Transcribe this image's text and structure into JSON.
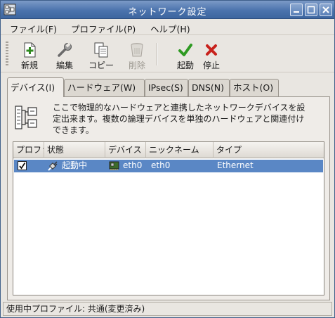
{
  "window": {
    "title": "ネットワーク設定",
    "title_color": "#4b73ad"
  },
  "menubar": {
    "items": [
      {
        "label": "ファイル(F)"
      },
      {
        "label": "プロファイル(P)"
      },
      {
        "label": "ヘルプ(H)"
      }
    ]
  },
  "toolbar": {
    "buttons": [
      {
        "label": "新規",
        "icon": "new-icon",
        "enabled": true
      },
      {
        "label": "編集",
        "icon": "edit-icon",
        "enabled": true
      },
      {
        "label": "コピー",
        "icon": "copy-icon",
        "enabled": true
      },
      {
        "label": "削除",
        "icon": "delete-icon",
        "enabled": false
      },
      {
        "label": "起動",
        "icon": "activate-icon",
        "enabled": true
      },
      {
        "label": "停止",
        "icon": "deactivate-icon",
        "enabled": true
      }
    ]
  },
  "tabs": [
    {
      "label": "デバイス(I)",
      "active": true
    },
    {
      "label": "ハードウェア(W)",
      "active": false
    },
    {
      "label": "IPsec(S)",
      "active": false
    },
    {
      "label": "DNS(N)",
      "active": false
    },
    {
      "label": "ホスト(O)",
      "active": false
    }
  ],
  "devices_panel": {
    "description": "ここで物理的なハードウェアと連携したネットワークデバイスを設定出来ます。複数の論理デバイスを単独のハードウェアと関連付けできます。",
    "columns": [
      "プロファイル",
      "状態",
      "デバイス",
      "ニックネーム",
      "タイプ"
    ],
    "rows": [
      {
        "profile_checked": true,
        "status": "起動中",
        "device": "eth0",
        "nickname": "eth0",
        "type": "Ethernet"
      }
    ],
    "selected_row_color": "#5a87c5"
  },
  "statusbar": {
    "text": "使用中プロファイル: 共通(変更済み)"
  }
}
